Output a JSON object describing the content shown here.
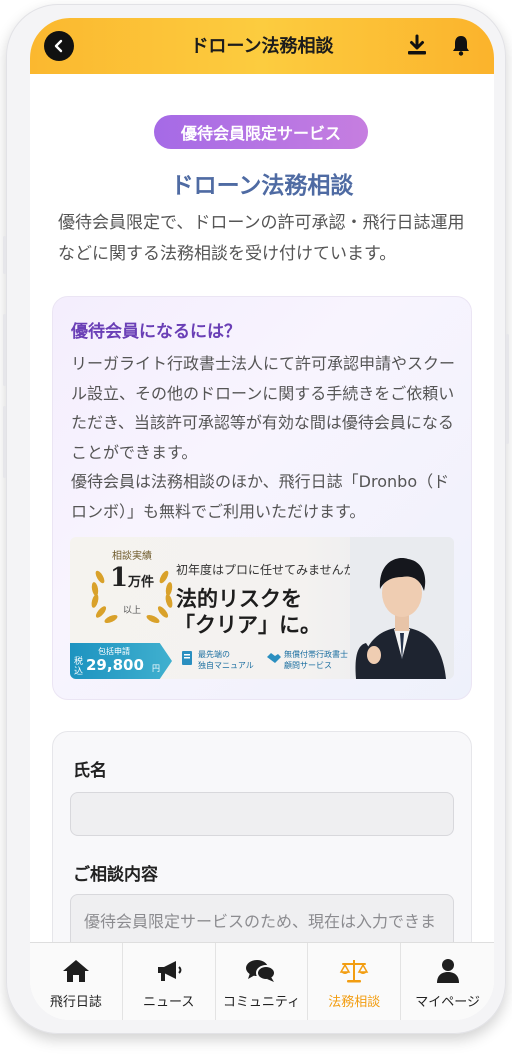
{
  "header": {
    "title": "ドローン法務相談",
    "back_icon": "chevron-left-icon",
    "download_icon": "download-icon",
    "bell_icon": "bell-icon"
  },
  "main": {
    "badge": "優待会員限定サービス",
    "title": "ドローン法務相談",
    "intro": "優待会員限定で、ドローンの許可承認・飛行日誌運用などに関する法務相談を受け付けています。"
  },
  "membership": {
    "heading": "優待会員になるには？",
    "body_lines": [
      "リーガライト行政書士法人にて許可承認申請やスクール設立、その他のドローンに関する手続きをご依頼いただき、当該許可承認等が有効な間は優待会員になることができます。",
      "優待会員は法務相談のほか、飛行日誌「Dronbo（ドロンボ）」も無料でご利用いただけます。"
    ],
    "banner": {
      "badge_label": "相談実績",
      "badge_number": "1",
      "badge_unit": "万件",
      "badge_sub": "以上",
      "tagline": "初年度はプロに任せてみませんか？",
      "headline_1": "法的リスクを",
      "headline_2": "「クリア」に。",
      "price_top": "包括申請",
      "price_prefix": "税込",
      "price": "29,800",
      "price_unit": "円",
      "feature_1": "最先端の\n独自マニュアル",
      "feature_2": "無償付帯行政書士\n顧問サービス"
    }
  },
  "form": {
    "name_label": "氏名",
    "name_value": "",
    "consult_label": "ご相談内容",
    "consult_placeholder": "優待会員限定サービスのため、現在は入力できません"
  },
  "tabbar": {
    "items": [
      {
        "label": "飛行日誌",
        "icon": "home-icon"
      },
      {
        "label": "ニュース",
        "icon": "megaphone-icon"
      },
      {
        "label": "コミュニティ",
        "icon": "chat-icon"
      },
      {
        "label": "法務相談",
        "icon": "scale-icon",
        "active": true
      },
      {
        "label": "マイページ",
        "icon": "user-icon"
      }
    ],
    "active_color": "#f29d11"
  },
  "colors": {
    "header": "#fcc23a",
    "accent_purple": "#a56ae6",
    "title_blue": "#4f6ba3"
  }
}
